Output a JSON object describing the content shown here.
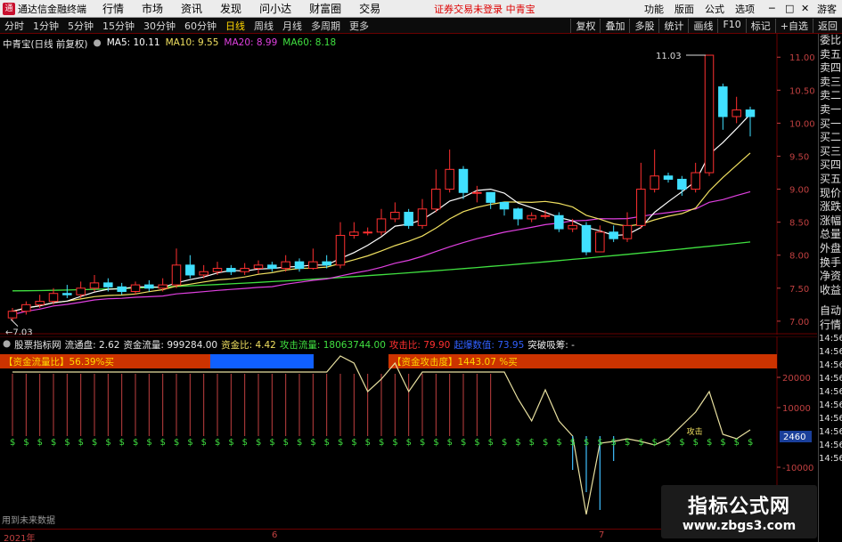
{
  "topbar": {
    "app_title": "通达信金融终端",
    "menu": [
      "行情",
      "市场",
      "资讯",
      "发现",
      "问小达",
      "财富圈",
      "交易"
    ],
    "notice": "证券交易未登录 中青宝",
    "right_menu": [
      "功能",
      "版面",
      "公式",
      "选项"
    ],
    "guest": "游客"
  },
  "periodbar": {
    "periods": [
      "分时",
      "1分钟",
      "5分钟",
      "15分钟",
      "30分钟",
      "60分钟",
      "日线",
      "周线",
      "月线",
      "多周期",
      "更多"
    ],
    "active_period": "日线",
    "tools": [
      "复权",
      "叠加",
      "多股",
      "统计",
      "画线",
      "F10",
      "标记",
      "+自选",
      "返回"
    ]
  },
  "legend_main": {
    "stock": "中青宝(日线 前复权)",
    "ma5": "MA5: 10.11",
    "ma10": "MA10: 9.55",
    "ma20": "MA20: 8.99",
    "ma60": "MA60: 8.18"
  },
  "legend_sub": {
    "indicator": "股票指标网",
    "liutong": "流通盘: 2.62",
    "zijin": "资金流量: 999284.00",
    "zijinbi": "资金比: 4.42",
    "gongji": "攻击流量: 18063744.00",
    "gongjibi": "攻击比: 79.90",
    "qidian": "起爆数值: 73.95",
    "tupo": "突破吸筹: -"
  },
  "main_annot": {
    "high": "11.03",
    "low": "7.03"
  },
  "sub_annot": {
    "bar_label_1": "【资金流量比】56.39%买",
    "bar_label_2": "【资金攻击度】1443.07 %买",
    "current_value": "2460",
    "signal_text": "攻击",
    "footnote": "用到未来数据"
  },
  "price_axis": [
    "11.00",
    "10.50",
    "10.00",
    "9.50",
    "9.00",
    "8.50",
    "8.00",
    "7.50",
    "7.00"
  ],
  "sub_axis": [
    "20000",
    "10000",
    "-10000"
  ],
  "x_axis": [
    "2021年",
    "6",
    "7"
  ],
  "sidebar": [
    "委比",
    "卖五",
    "卖四",
    "卖三",
    "卖二",
    "卖一",
    "买一",
    "买二",
    "买三",
    "买四",
    "买五",
    "现价",
    "涨跌",
    "涨幅",
    "总量",
    "外盘",
    "换手",
    "净资",
    "收益",
    "自动",
    "行情",
    "14:56",
    "14:56",
    "14:56",
    "14:56",
    "14:56",
    "14:56",
    "14:56",
    "14:56",
    "14:56",
    "14:56"
  ],
  "candles": [
    [
      7.05,
      7.15,
      7.2,
      7.0
    ],
    [
      7.15,
      7.25,
      7.3,
      7.1
    ],
    [
      7.25,
      7.3,
      7.4,
      7.2
    ],
    [
      7.3,
      7.42,
      7.5,
      7.25
    ],
    [
      7.42,
      7.4,
      7.55,
      7.35
    ],
    [
      7.4,
      7.5,
      7.6,
      7.35
    ],
    [
      7.5,
      7.58,
      7.7,
      7.45
    ],
    [
      7.58,
      7.52,
      7.65,
      7.45
    ],
    [
      7.52,
      7.45,
      7.58,
      7.4
    ],
    [
      7.45,
      7.55,
      7.6,
      7.4
    ],
    [
      7.55,
      7.5,
      7.62,
      7.45
    ],
    [
      7.5,
      7.55,
      7.65,
      7.45
    ],
    [
      7.55,
      7.85,
      8.1,
      7.5
    ],
    [
      7.85,
      7.7,
      8.0,
      7.65
    ],
    [
      7.7,
      7.75,
      7.85,
      7.65
    ],
    [
      7.75,
      7.8,
      7.9,
      7.7
    ],
    [
      7.8,
      7.75,
      7.85,
      7.7
    ],
    [
      7.75,
      7.8,
      7.88,
      7.7
    ],
    [
      7.8,
      7.85,
      7.92,
      7.72
    ],
    [
      7.85,
      7.8,
      7.9,
      7.75
    ],
    [
      7.8,
      7.9,
      8.0,
      7.75
    ],
    [
      7.9,
      7.8,
      7.95,
      7.75
    ],
    [
      7.8,
      7.9,
      8.1,
      7.78
    ],
    [
      7.9,
      7.85,
      8.0,
      7.8
    ],
    [
      7.85,
      8.3,
      8.5,
      7.8
    ],
    [
      8.3,
      8.35,
      8.5,
      8.25
    ],
    [
      8.35,
      8.35,
      8.42,
      8.3
    ],
    [
      8.35,
      8.55,
      8.7,
      8.3
    ],
    [
      8.55,
      8.65,
      8.8,
      8.5
    ],
    [
      8.65,
      8.45,
      8.7,
      8.4
    ],
    [
      8.45,
      8.7,
      8.85,
      8.4
    ],
    [
      8.7,
      9.0,
      9.3,
      8.65
    ],
    [
      9.0,
      9.3,
      9.6,
      8.95
    ],
    [
      9.3,
      8.95,
      9.35,
      8.85
    ],
    [
      8.95,
      8.95,
      9.05,
      8.8
    ],
    [
      8.95,
      8.8,
      8.95,
      8.7
    ],
    [
      8.8,
      8.7,
      8.8,
      8.6
    ],
    [
      8.7,
      8.55,
      8.72,
      8.45
    ],
    [
      8.55,
      8.6,
      8.65,
      8.5
    ],
    [
      8.6,
      8.6,
      8.68,
      8.55
    ],
    [
      8.6,
      8.4,
      8.65,
      8.35
    ],
    [
      8.4,
      8.45,
      8.55,
      8.35
    ],
    [
      8.45,
      8.05,
      8.5,
      8.0
    ],
    [
      8.05,
      8.35,
      8.45,
      8.05
    ],
    [
      8.35,
      8.25,
      8.45,
      8.2
    ],
    [
      8.25,
      8.45,
      8.65,
      8.2
    ],
    [
      8.45,
      9.0,
      9.4,
      8.4
    ],
    [
      9.0,
      9.2,
      9.6,
      8.95
    ],
    [
      9.2,
      9.15,
      9.25,
      9.1
    ],
    [
      9.15,
      9.0,
      9.2,
      8.9
    ],
    [
      9.0,
      9.25,
      9.4,
      8.95
    ],
    [
      9.25,
      11.03,
      11.03,
      9.2
    ],
    [
      10.55,
      10.1,
      10.6,
      9.9
    ],
    [
      10.1,
      10.2,
      10.4,
      10.0
    ],
    [
      10.2,
      10.1,
      10.25,
      9.8
    ]
  ],
  "colors": {
    "up": "#ff3030",
    "down": "#40e0ff",
    "ma5": "#ffffff",
    "ma10": "#f0e060",
    "ma20": "#e040e0",
    "ma60": "#40e040",
    "accent": "#ffd700",
    "sell_bar": "#cc3300",
    "buy_bar": "#1060ff"
  }
}
